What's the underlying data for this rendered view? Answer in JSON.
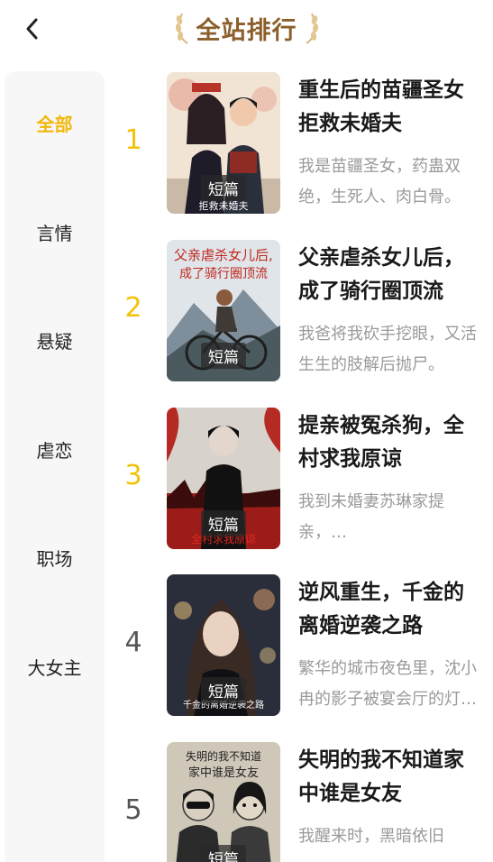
{
  "header": {
    "title": "全站排行",
    "back_icon": "chevron-left-icon",
    "laurel_icon": "laurel-icon"
  },
  "colors": {
    "accent": "#f2b70a",
    "title": "#8b5e2a",
    "sidebar_bg": "#f7f7f7",
    "desc": "#9a9a9a"
  },
  "sidebar": {
    "items": [
      {
        "label": "全部",
        "active": true
      },
      {
        "label": "言情",
        "active": false
      },
      {
        "label": "悬疑",
        "active": false
      },
      {
        "label": "虐恋",
        "active": false
      },
      {
        "label": "职场",
        "active": false
      },
      {
        "label": "大女主",
        "active": false
      }
    ]
  },
  "books": [
    {
      "rank": "1",
      "title": "重生后的苗疆圣女拒救未婚夫",
      "desc": "我是苗疆圣女，药蛊双绝，生死人、肉白骨。",
      "badge": "短篇"
    },
    {
      "rank": "2",
      "title": "父亲虐杀女儿后，成了骑行圈顶流",
      "desc": "我爸将我砍手挖眼，又活生生的肢解后抛尸。",
      "badge": "短篇"
    },
    {
      "rank": "3",
      "title": "提亲被冤杀狗，全村求我原谅",
      "desc": "我到未婚妻苏琳家提亲，…",
      "badge": "短篇"
    },
    {
      "rank": "4",
      "title": "逆风重生，千金的离婚逆袭之路",
      "desc": "繁华的城市夜色里，沈小冉的影子被宴会厅的灯光拉长。",
      "badge": "短篇"
    },
    {
      "rank": "5",
      "title": "失明的我不知道家中谁是女友",
      "desc": "我醒来时，黑暗依旧",
      "badge": "短篇"
    }
  ]
}
